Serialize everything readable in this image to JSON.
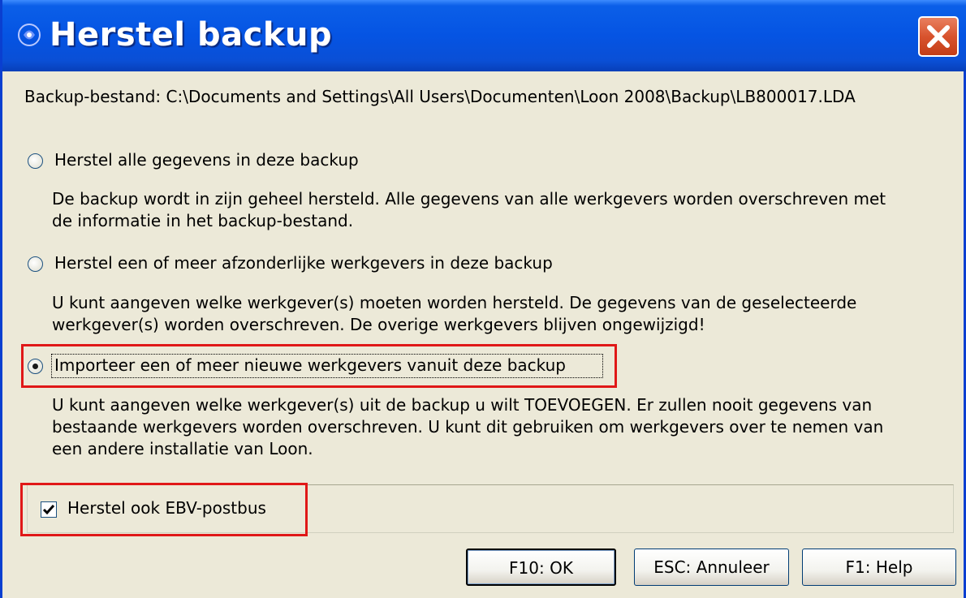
{
  "window": {
    "title": "Herstel backup",
    "title_color": "#ffffff",
    "titlebar_color": "#0554e3"
  },
  "backup_file": {
    "label": "Backup-bestand: C:\\Documents and Settings\\All Users\\Documenten\\Loon 2008\\Backup\\LB800017.LDA"
  },
  "options": [
    {
      "label": "Herstel alle gegevens in deze backup",
      "selected": false,
      "description": [
        "De backup wordt in zijn geheel hersteld. Alle gegevens van alle werkgevers worden overschreven met",
        "de informatie in het backup-bestand."
      ]
    },
    {
      "label": "Herstel een of meer afzonderlijke werkgevers in deze backup",
      "selected": false,
      "description": [
        "U kunt aangeven welke werkgever(s) moeten worden hersteld. De gegevens van de geselecteerde",
        "werkgever(s) worden overschreven. De overige werkgevers blijven ongewijzigd!"
      ]
    },
    {
      "label": "Importeer een of meer nieuwe werkgevers vanuit deze backup",
      "selected": true,
      "description": [
        "U kunt aangeven welke werkgever(s) uit de backup u wilt TOEVOEGEN. Er zullen nooit gegevens van",
        "bestaande werkgevers worden overschreven. U kunt dit gebruiken om werkgevers over te nemen van",
        "een andere installatie van Loon."
      ]
    }
  ],
  "ebv_checkbox": {
    "label": "Herstel ook EBV-postbus",
    "checked": true
  },
  "buttons": {
    "ok": "F10: OK",
    "cancel": "ESC: Annuleer",
    "help": "F1: Help"
  },
  "highlight_color": "#e01818"
}
